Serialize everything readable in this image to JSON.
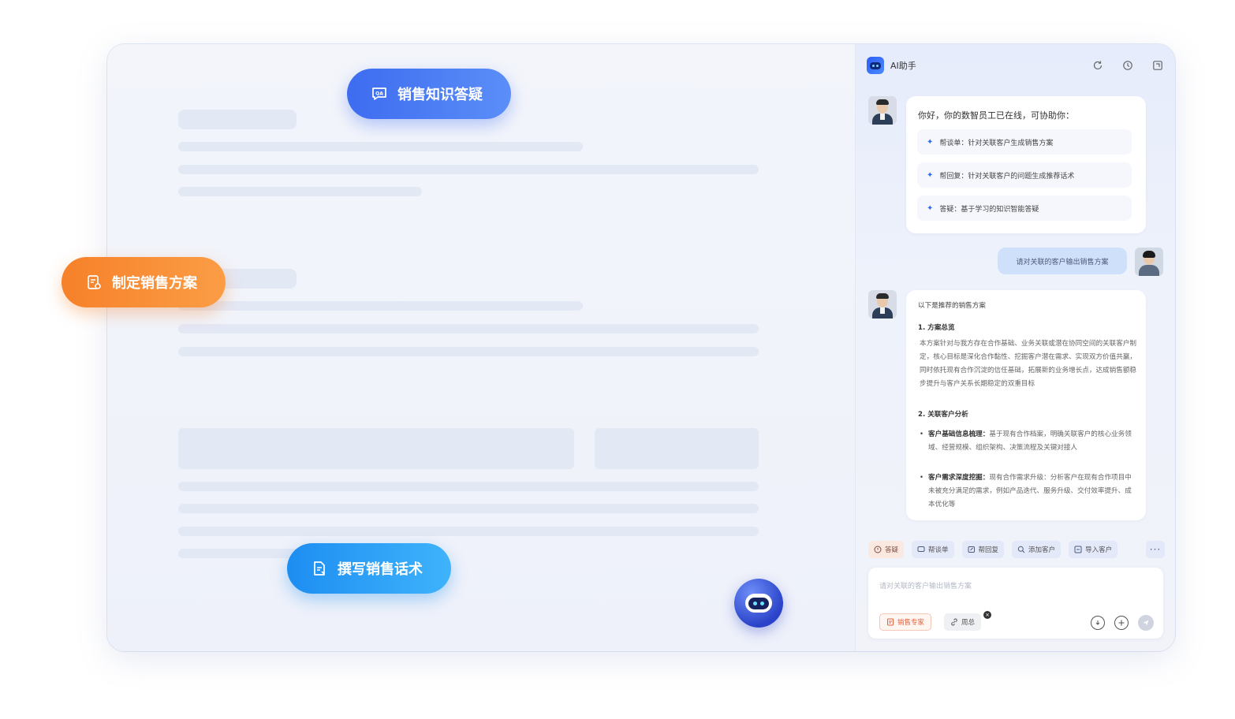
{
  "feature_pills": {
    "qa": "销售知识答疑",
    "plan": "制定销售方案",
    "script": "撰写销售话术"
  },
  "assistant": {
    "title": "AI助手",
    "header_icons": [
      "refresh-icon",
      "history-icon",
      "expand-panel-icon"
    ],
    "greeting": {
      "title": "你好，你的数智员工已在线，可协助你：",
      "items": [
        "帮谈单：针对关联客户生成销售方案",
        "帮回复：针对关联客户的问题生成推荐话术",
        "答疑：基于学习的知识智能答疑"
      ]
    },
    "user_message": "请对关联的客户输出销售方案",
    "reply": {
      "intro": "以下是推荐的销售方案",
      "section1_title": "1. 方案总览",
      "section1_body": "本方案针对与我方存在合作基础、业务关联或潜在协同空间的关联客户制定，核心目标是深化合作黏性、挖掘客户潜在需求、实现双方价值共赢，同时依托现有合作沉淀的信任基础，拓展新的业务增长点，达成销售额稳步提升与客户关系长期稳定的双重目标",
      "section2_title": "2. 关联客户分析",
      "bullet1_label": "客户基础信息梳理：",
      "bullet1_text": "基于现有合作档案，明确关联客户的核心业务领域、经营规模、组织架构、决策流程及关键对接人",
      "bullet2_label": "客户需求深度挖掘：",
      "bullet2_text": "现有合作需求升级：分析客户在现有合作项目中未被充分满足的需求，例如产品迭代、服务升级、交付效率提升、成本优化等"
    },
    "toolbar": {
      "qa": "答疑",
      "deal": "帮谈单",
      "reply": "帮回复",
      "add_customer": "添加客户",
      "import_customer": "导入客户",
      "more": "···"
    },
    "input": {
      "placeholder": "请对关联的客户输出销售方案",
      "tag_expert": "销售专家",
      "tag_person": "周总"
    },
    "colors": {
      "accent": "#2f6bf3",
      "orange": "#f6812a",
      "sky": "#1d8ef2"
    }
  }
}
